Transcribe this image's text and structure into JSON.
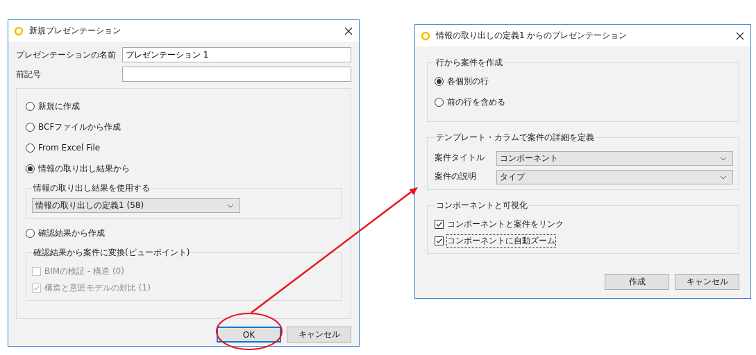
{
  "new_dialog": {
    "title": "新規プレゼンテーション",
    "fields": [
      {
        "label": "プレゼンテーションの名前",
        "value": "プレゼンテーション 1"
      },
      {
        "label": "前記号"
      }
    ],
    "options": [
      {
        "label": "新規に作成",
        "selected": false
      },
      {
        "label": "BCFファイルから作成",
        "selected": false
      },
      {
        "label": "From Excel File",
        "selected": false
      },
      {
        "label": "情報の取り出し結果から",
        "selected": true,
        "group": {
          "title": "情報の取り出し結果を使用する",
          "kind": "dropdown",
          "value": "情報の取り出しの定義1 (58)"
        }
      },
      {
        "label": "確認結果から作成",
        "selected": false,
        "group": {
          "title": "確認結果から案件に変換(ビューポイント)",
          "kind": "checkboxes",
          "items": [
            {
              "label": "BIMの検証 - 構造 (0)",
              "checked": false,
              "disabled": true,
              "focused": false
            },
            {
              "label": "構造と意匠モデルの対比 (1)",
              "checked": true,
              "disabled": true,
              "focused": false
            }
          ]
        }
      }
    ],
    "buttons": [
      {
        "label": "OK",
        "default": true
      },
      {
        "label": "キャンセル",
        "default": false
      }
    ]
  },
  "extraction_dialog": {
    "title": "情報の取り出しの定義1 からのプレゼンテーション",
    "groups": [
      {
        "title": "行から案件を作成",
        "kind": "radios",
        "items": [
          {
            "label": "各個別の行",
            "selected": true
          },
          {
            "label": "前の行を含める",
            "selected": false
          }
        ]
      },
      {
        "title": "テンプレート・カラムで案件の詳細を定義",
        "kind": "selects",
        "items": [
          {
            "label": "案件タイトル",
            "value": "コンポーネント"
          },
          {
            "label": "案件の説明",
            "value": "タイプ"
          }
        ]
      },
      {
        "title": "コンポーネントと可視化",
        "kind": "checkboxes",
        "items": [
          {
            "label": "コンポーネントと案件をリンク",
            "checked": true,
            "disabled": false,
            "focused": false
          },
          {
            "label": "コンポーネントに自動ズーム",
            "checked": true,
            "disabled": false,
            "focused": true
          }
        ]
      }
    ],
    "buttons": [
      {
        "label": "作成",
        "default": false
      },
      {
        "label": "キャンセル",
        "default": false
      }
    ]
  }
}
